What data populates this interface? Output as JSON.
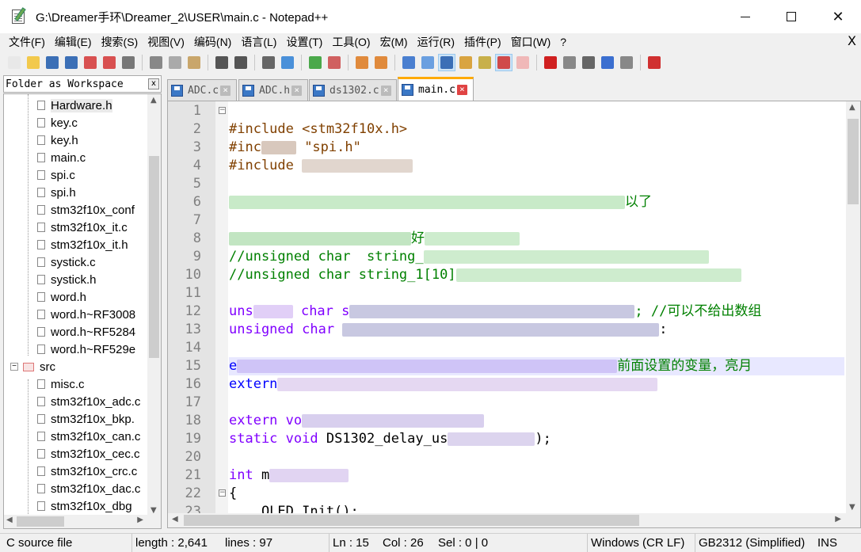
{
  "window": {
    "title": "G:\\Dreamer手环\\Dreamer_2\\USER\\main.c - Notepad++"
  },
  "menu": [
    "文件(F)",
    "编辑(E)",
    "搜索(S)",
    "视图(V)",
    "编码(N)",
    "语言(L)",
    "设置(T)",
    "工具(O)",
    "宏(M)",
    "运行(R)",
    "插件(P)",
    "窗口(W)",
    "?"
  ],
  "menu_close": "X",
  "toolbar_icons": [
    "new-file-icon",
    "open-file-icon",
    "save-icon",
    "save-all-icon",
    "close-icon",
    "close-all-icon",
    "print-icon",
    "cut-icon",
    "copy-icon",
    "paste-icon",
    "undo-icon",
    "redo-icon",
    "find-icon",
    "replace-icon",
    "zoom-in-icon",
    "zoom-out-icon",
    "sync-vertical-icon",
    "sync-horizontal-icon",
    "word-wrap-icon",
    "show-all-chars-icon",
    "indent-guide-icon",
    "language-icon",
    "function-list-icon",
    "folder-workspace-icon",
    "document-map-icon",
    "record-macro-icon",
    "stop-record-icon",
    "play-macro-icon",
    "run-macro-multiple-icon",
    "save-macro-icon",
    "spell-check-icon"
  ],
  "panel": {
    "title": "Folder as Workspace",
    "close": "x"
  },
  "tree": {
    "items": [
      {
        "label": "Hardware.h",
        "type": "file",
        "level": 2,
        "selected": true
      },
      {
        "label": "key.c",
        "type": "file",
        "level": 2
      },
      {
        "label": "key.h",
        "type": "file",
        "level": 2
      },
      {
        "label": "main.c",
        "type": "file",
        "level": 2
      },
      {
        "label": "spi.c",
        "type": "file",
        "level": 2
      },
      {
        "label": "spi.h",
        "type": "file",
        "level": 2
      },
      {
        "label": "stm32f10x_conf",
        "type": "file",
        "level": 2
      },
      {
        "label": "stm32f10x_it.c",
        "type": "file",
        "level": 2
      },
      {
        "label": "stm32f10x_it.h",
        "type": "file",
        "level": 2
      },
      {
        "label": "systick.c",
        "type": "file",
        "level": 2
      },
      {
        "label": "systick.h",
        "type": "file",
        "level": 2
      },
      {
        "label": "word.h",
        "type": "file",
        "level": 2
      },
      {
        "label": "word.h~RF3008",
        "type": "file",
        "level": 2
      },
      {
        "label": "word.h~RF5284",
        "type": "file",
        "level": 2
      },
      {
        "label": "word.h~RF529e",
        "type": "file",
        "level": 2
      },
      {
        "label": "src",
        "type": "folder",
        "level": 1
      },
      {
        "label": "misc.c",
        "type": "file",
        "level": 2
      },
      {
        "label": "stm32f10x_adc.c",
        "type": "file",
        "level": 2
      },
      {
        "label": "stm32f10x_bkp.",
        "type": "file",
        "level": 2
      },
      {
        "label": "stm32f10x_can.c",
        "type": "file",
        "level": 2
      },
      {
        "label": "stm32f10x_cec.c",
        "type": "file",
        "level": 2
      },
      {
        "label": "stm32f10x_crc.c",
        "type": "file",
        "level": 2
      },
      {
        "label": "stm32f10x_dac.c",
        "type": "file",
        "level": 2
      },
      {
        "label": "stm32f10x_dbg",
        "type": "file",
        "level": 2
      }
    ]
  },
  "tabs": [
    {
      "label": "ADC.c",
      "active": false
    },
    {
      "label": "ADC.h",
      "active": false
    },
    {
      "label": "ds1302.c",
      "active": false
    },
    {
      "label": "main.c",
      "active": true
    }
  ],
  "editor": {
    "lines": [
      {
        "n": "1",
        "segments": []
      },
      {
        "n": "2",
        "segments": [
          {
            "t": "#include <stm32f10x.h>",
            "c": "kw-pre"
          }
        ]
      },
      {
        "n": "3",
        "segments": [
          {
            "t": "#inc",
            "c": "kw-pre"
          },
          {
            "blur": 44,
            "col": "#b89a86"
          },
          {
            "t": " \"spi.h\"",
            "c": "kw-pre"
          }
        ]
      },
      {
        "n": "4",
        "segments": [
          {
            "t": "#include ",
            "c": "kw-pre"
          },
          {
            "blur": 140,
            "col": "#c8b4a6"
          }
        ]
      },
      {
        "n": "5",
        "segments": []
      },
      {
        "n": "6",
        "segments": [
          {
            "blur": 500,
            "col": "#9bd89b"
          },
          {
            "t": "以了",
            "c": "cmt"
          }
        ]
      },
      {
        "n": "7",
        "segments": []
      },
      {
        "n": "8",
        "segments": [
          {
            "blur": 230,
            "col": "#8fd08f"
          },
          {
            "t": "好",
            "c": "cmt"
          },
          {
            "blur": 120,
            "col": "#a4dca4"
          }
        ]
      },
      {
        "n": "9",
        "segments": [
          {
            "t": "//unsigned char  string_",
            "c": "cmt"
          },
          {
            "blur": 360,
            "col": "#a6dca6"
          }
        ]
      },
      {
        "n": "10",
        "segments": [
          {
            "t": "//unsigned char string_1[10]",
            "c": "cmt"
          },
          {
            "blur": 360,
            "col": "#a6dca6"
          }
        ]
      },
      {
        "n": "11",
        "segments": []
      },
      {
        "n": "12",
        "segments": [
          {
            "t": "uns",
            "c": "kw-type"
          },
          {
            "blur": 50,
            "col": "#c8a8f0"
          },
          {
            "t": " char s",
            "c": "kw-type"
          },
          {
            "blur": 360,
            "col": "#9a9ac8"
          },
          {
            "t": "; //可以不给出数组",
            "c": "cmt"
          }
        ]
      },
      {
        "n": "13",
        "segments": [
          {
            "t": "unsigned char ",
            "c": "kw-type"
          },
          {
            "blur": 400,
            "col": "#9a9ac8"
          },
          {
            "t": ":",
            "c": ""
          }
        ]
      },
      {
        "n": "14",
        "segments": []
      },
      {
        "n": "15",
        "hl": true,
        "segments": [
          {
            "t": "e",
            "c": "kw-blue"
          },
          {
            "blur": 480,
            "col": "#b9a6f0"
          },
          {
            "t": "前面设置的变量，亮月",
            "c": "cmt"
          }
        ]
      },
      {
        "n": "16",
        "segments": [
          {
            "t": "extern",
            "c": "kw-blue"
          },
          {
            "blur": 480,
            "col": "#d0b8e8"
          }
        ]
      },
      {
        "n": "17",
        "segments": []
      },
      {
        "n": "18",
        "segments": [
          {
            "t": "extern vo",
            "c": "kw-type"
          },
          {
            "blur": 230,
            "col": "#b8a8e0"
          }
        ]
      },
      {
        "n": "19",
        "segments": [
          {
            "t": "static void ",
            "c": "kw-type"
          },
          {
            "t": "DS1302_delay_us",
            "c": ""
          },
          {
            "blur": 110,
            "col": "#c0b0e0"
          },
          {
            "t": ");",
            "c": ""
          }
        ]
      },
      {
        "n": "20",
        "segments": []
      },
      {
        "n": "21",
        "segments": [
          {
            "t": "int ",
            "c": "kw-type"
          },
          {
            "t": "m",
            "c": ""
          },
          {
            "blur": 100,
            "col": "#c8b0e8"
          }
        ]
      },
      {
        "n": "22",
        "segments": [
          {
            "t": "{",
            "c": ""
          }
        ]
      },
      {
        "n": "23",
        "segments": [
          {
            "t": "    OLED_Init();",
            "c": ""
          }
        ]
      }
    ]
  },
  "status": {
    "file_type": "C source file",
    "length": "length : 2,641",
    "lines": "lines : 97",
    "ln": "Ln : 15",
    "col": "Col : 26",
    "sel": "Sel : 0 | 0",
    "eol": "Windows (CR LF)",
    "encoding": "GB2312 (Simplified)",
    "mode": "INS"
  }
}
